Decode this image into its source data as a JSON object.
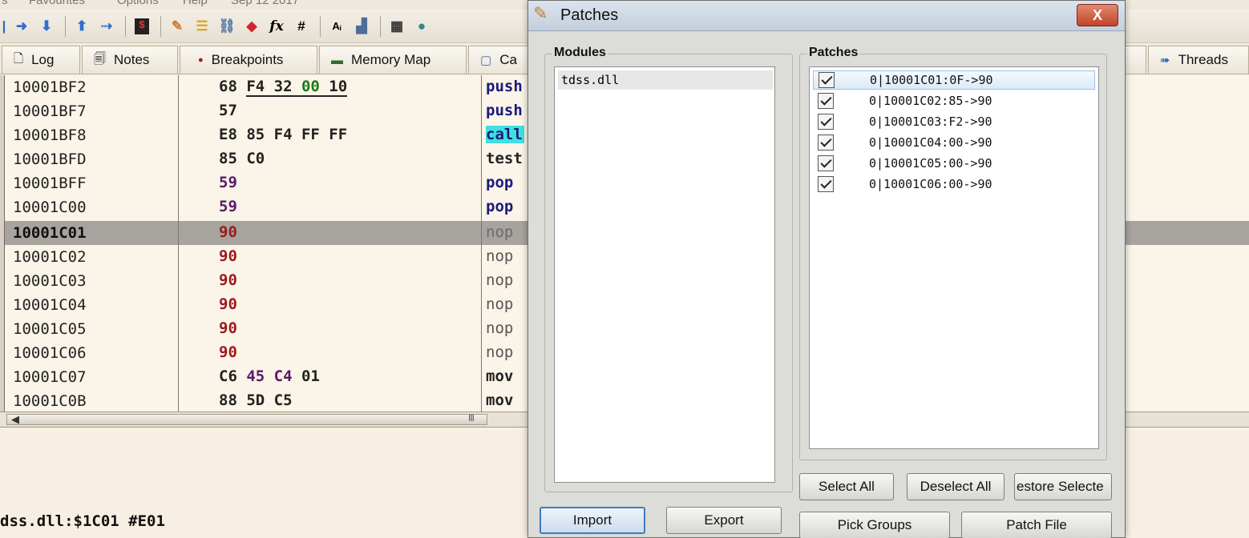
{
  "menu": {
    "items": [
      "s",
      "Favourites",
      "Options",
      "Help",
      "Sep 12 2017"
    ]
  },
  "toolbar": {
    "icons": [
      "step-over-icon",
      "step-into-icon",
      "sep",
      "step-out-icon",
      "run-to-user-icon",
      "sep",
      "script-icon",
      "sep",
      "patch-icon",
      "comment-icon",
      "link-icon",
      "breakpoint-icon",
      "fx-icon",
      "hash-icon",
      "sep",
      "font-icon",
      "memory-icon",
      "sep",
      "calculator-icon",
      "globe-icon"
    ]
  },
  "tabs": [
    {
      "label": "Log",
      "icon": "log-icon"
    },
    {
      "label": "Notes",
      "icon": "notes-icon"
    },
    {
      "label": "Breakpoints",
      "icon": "breakpoints-icon"
    },
    {
      "label": "Memory Map",
      "icon": "memory-map-icon"
    },
    {
      "label": "Ca",
      "icon": "callstack-icon"
    },
    {
      "label": "Threads",
      "icon": "threads-icon"
    }
  ],
  "disasm": {
    "rows": [
      {
        "addr": "10001BF2",
        "bytes": "68 F4 32 00 10",
        "instr": "push"
      },
      {
        "addr": "10001BF7",
        "bytes": "57",
        "instr": "push"
      },
      {
        "addr": "10001BF8",
        "bytes": "E8 85 F4 FF FF",
        "instr": "call"
      },
      {
        "addr": "10001BFD",
        "bytes": "85 C0",
        "instr": "test"
      },
      {
        "addr": "10001BFF",
        "bytes": "59",
        "instr": "pop"
      },
      {
        "addr": "10001C00",
        "bytes": "59",
        "instr": "pop"
      },
      {
        "addr": "10001C01",
        "bytes": "90",
        "instr": "nop"
      },
      {
        "addr": "10001C02",
        "bytes": "90",
        "instr": "nop"
      },
      {
        "addr": "10001C03",
        "bytes": "90",
        "instr": "nop"
      },
      {
        "addr": "10001C04",
        "bytes": "90",
        "instr": "nop"
      },
      {
        "addr": "10001C05",
        "bytes": "90",
        "instr": "nop"
      },
      {
        "addr": "10001C06",
        "bytes": "90",
        "instr": "nop"
      },
      {
        "addr": "10001C07",
        "bytes": "C6 45 C4 01",
        "instr": "mov"
      },
      {
        "addr": "10001C0B",
        "bytes": "88 5D C5",
        "instr": "mov"
      }
    ],
    "scroll_grip": "III"
  },
  "command_text": "dss.dll:$1C01 #E01",
  "dialog": {
    "title": "Patches",
    "close_label": "X",
    "modules_label": "Modules",
    "modules": [
      "tdss.dll"
    ],
    "patches_label": "Patches",
    "patches": [
      "0|10001C01:0F->90",
      "0|10001C02:85->90",
      "0|10001C03:F2->90",
      "0|10001C04:00->90",
      "0|10001C05:00->90",
      "0|10001C06:00->90"
    ],
    "buttons": {
      "import": "Import",
      "export": "Export",
      "select_all": "Select All",
      "deselect_all": "Deselect All",
      "restore_selected": "estore Selecte",
      "pick_groups": "Pick Groups",
      "patch_file": "Patch File"
    }
  }
}
